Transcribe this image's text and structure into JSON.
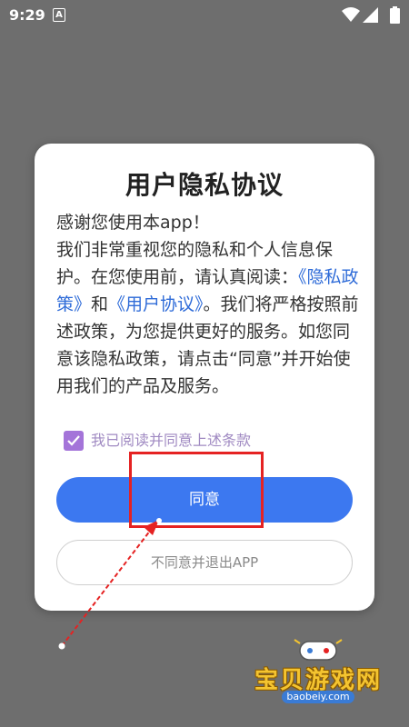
{
  "status_bar": {
    "time": "9:29",
    "notification_badge": "A",
    "icons": [
      "wifi-icon",
      "signal-icon",
      "battery-icon"
    ]
  },
  "dialog": {
    "title": "用户隐私协议",
    "body": {
      "greeting": "感谢您使用本app！",
      "paragraph_before_link1": "我们非常重视您的隐私和个人信息保护。在您使用前，请认真阅读：",
      "privacy_policy_link": "《隐私政策》",
      "conjunction": "和",
      "user_agreement_link": "《用户协议》",
      "paragraph_after_links": "。我们将严格按照前述政策，为您提供更好的服务。如您同意该隐私政策，请点击“同意”并开始使用我们的产品及服务。"
    },
    "agree_checkbox": {
      "checked": true,
      "label": "我已阅读并同意上述条款"
    },
    "agree_button": "同意",
    "decline_button": "不同意并退出APP"
  },
  "colors": {
    "overlay_background": "#6e6e6e",
    "accent_button": "#3c78f0",
    "checkbox": "#a474d9",
    "link": "#2e6bd8",
    "annotation": "#e52222"
  },
  "watermark": {
    "text": "宝贝游戏网",
    "url": "baobeiy.com",
    "icon": "gamepad-logo-icon"
  }
}
